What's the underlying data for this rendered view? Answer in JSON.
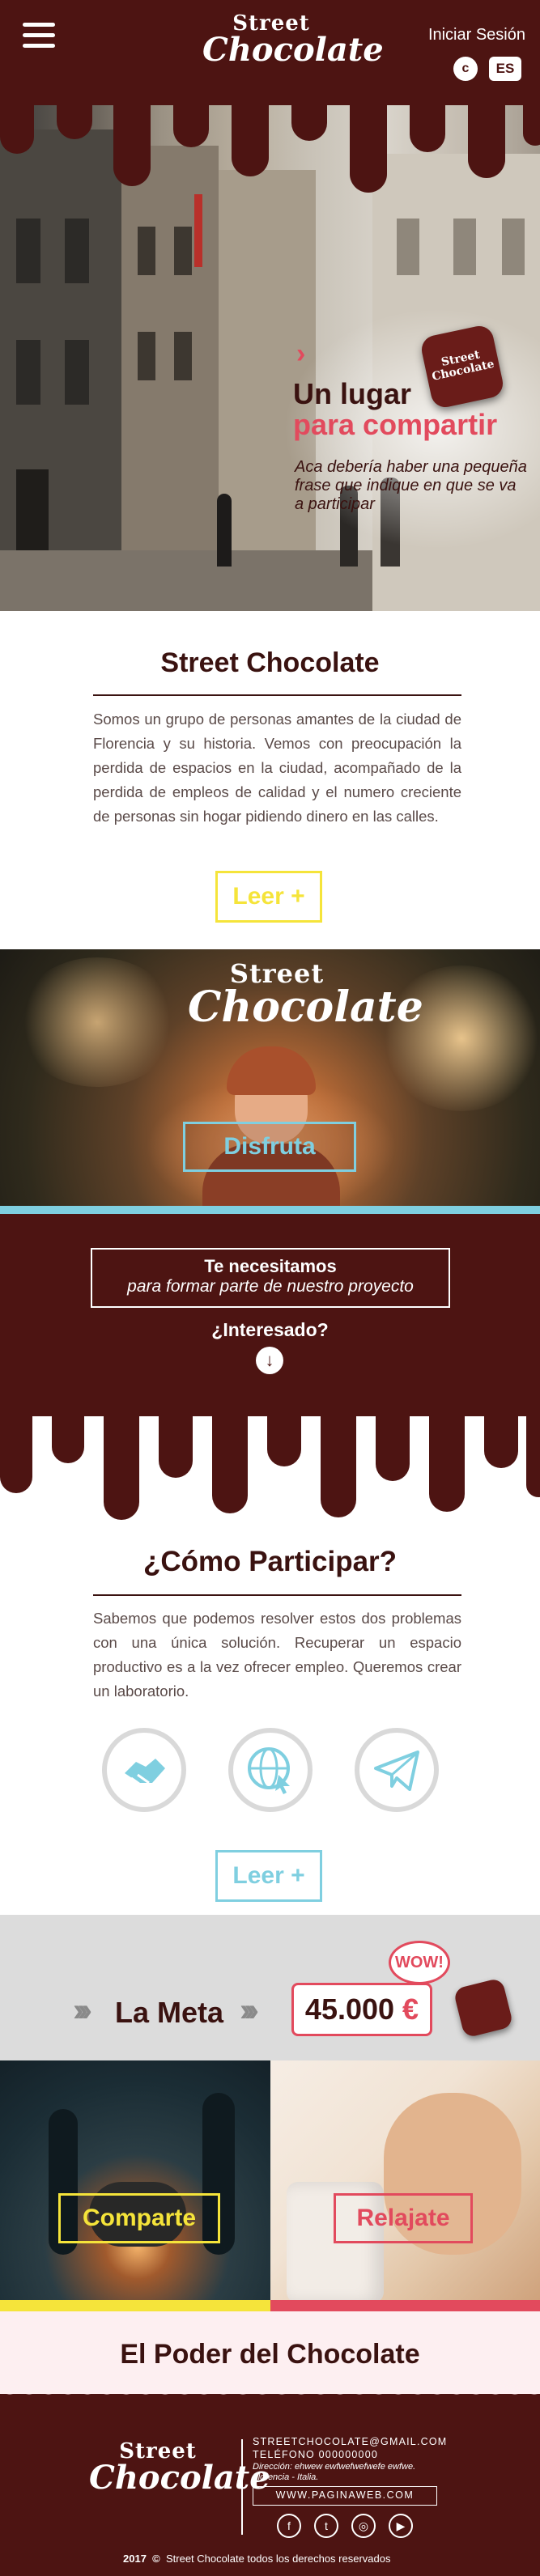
{
  "header": {
    "logo_line1": "Street",
    "logo_line2": "Chocolate",
    "login": "Iniciar Sesión",
    "lang_icon": "c",
    "lang": "ES"
  },
  "hero": {
    "title_line1": "Un lugar",
    "title_line2": "para compartir",
    "subtitle": "Aca debería haber una pequeña frase que indique en que se va a participar",
    "arrow": "›",
    "badge_line1": "Street",
    "badge_line2": "Chocolate"
  },
  "about": {
    "title": "Street Chocolate",
    "text": "Somos un grupo de personas amantes de la ciudad de Florencia y su historia. Vemos con preocupación la perdida de espacios en la ciudad, acompañado de la perdida de empleos de calidad y el numero creciente de personas sin hogar pidiendo dinero en las calles.",
    "button": "Leer +"
  },
  "enjoy": {
    "logo_line1": "Street",
    "logo_line2": "Chocolate",
    "button": "Disfruta"
  },
  "need": {
    "line1": "Te necesitamos",
    "line2": "para formar parte de nuestro proyecto",
    "question": "¿Interesado?",
    "arrow": "↓"
  },
  "participate": {
    "title": "¿Cómo Participar?",
    "text": "Sabemos que podemos resolver estos dos problemas con una única solución. Recuperar un espacio productivo es a la vez ofrecer empleo. Queremos crear un laboratorio.",
    "button": "Leer +",
    "icons": [
      "handshake-icon",
      "globe-cursor-icon",
      "paper-plane-icon"
    ]
  },
  "goal": {
    "label": "La Meta",
    "amount": "45.000",
    "currency": "€",
    "wow": "WOW!",
    "chevrons": "›››"
  },
  "photos": {
    "share": "Comparte",
    "relax": "Relajate"
  },
  "power": {
    "title": "El Poder del Chocolate"
  },
  "footer": {
    "logo_line1": "Street",
    "logo_line2": "Chocolate",
    "email": "STREETCHOCOLATE@GMAIL.COM",
    "phone": "TELÉFONO 000000000",
    "address1": "Dirección: ehwew ewfwefwefwefe ewfwe.",
    "address2": "Florencia - Italia.",
    "web": "WWW.PAGINAWEB.COM",
    "social": [
      "f",
      "t",
      "◎",
      "▶"
    ],
    "copyright_year": "2017",
    "copyright_symbol": "©",
    "copyright_text": "Street Chocolate todos los derechos reservados"
  },
  "colors": {
    "chocolate": "#4d1412",
    "pink": "#e24a5d",
    "yellow": "#f5e43a",
    "cyan": "#7fcfe0"
  }
}
